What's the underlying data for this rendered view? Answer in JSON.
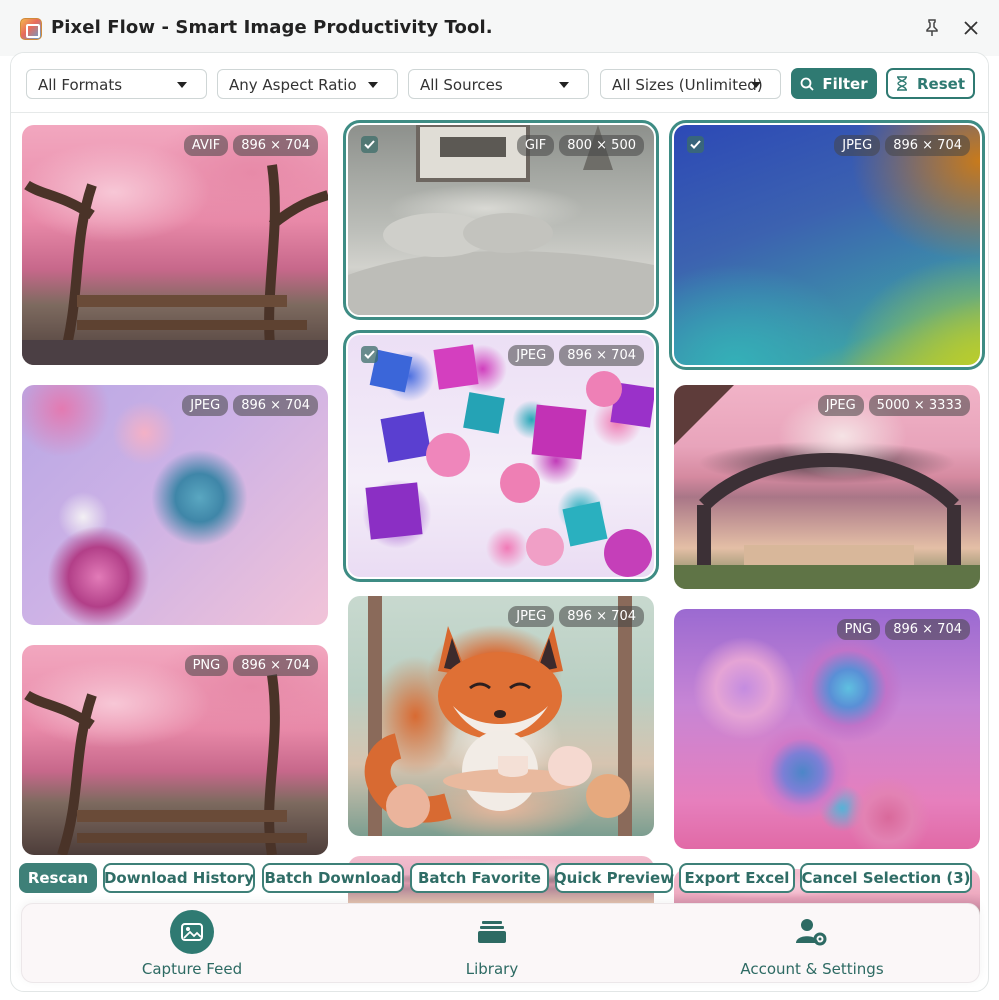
{
  "window": {
    "title": "Pixel Flow - Smart Image Productivity Tool.",
    "pin_icon": "pin-icon",
    "close_icon": "close-icon"
  },
  "filters": {
    "format": "All Formats",
    "aspect": "Any Aspect Ratio",
    "source": "All Sources",
    "size": "All Sizes (Unlimited)",
    "filter_label": "Filter",
    "reset_label": "Reset"
  },
  "images": [
    {
      "format": "AVIF",
      "dims": "896 × 704",
      "selected": false,
      "subject": "cherry blossom trees over wooden bridge"
    },
    {
      "format": "GIF",
      "dims": "800 × 500",
      "selected": true,
      "subject": "grey bedroom with pillows"
    },
    {
      "format": "JPEG",
      "dims": "896 × 704",
      "selected": true,
      "subject": "blue-orange-green gradient"
    },
    {
      "format": "JPEG",
      "dims": "896 × 704",
      "selected": false,
      "subject": "pastel spheres"
    },
    {
      "format": "JPEG",
      "dims": "896 × 704",
      "selected": true,
      "subject": "pink and blue cubes and spheres"
    },
    {
      "format": "JPEG",
      "dims": "5000 × 3333",
      "selected": false,
      "subject": "cherry blossom arched bridge"
    },
    {
      "format": "PNG",
      "dims": "896 × 704",
      "selected": false,
      "subject": "cherry blossom trees over wooden bridge"
    },
    {
      "format": "JPEG",
      "dims": "896 × 704",
      "selected": false,
      "subject": "fox having tea"
    },
    {
      "format": "PNG",
      "dims": "896 × 704",
      "selected": false,
      "subject": "purple and blue spheres"
    }
  ],
  "actions": {
    "rescan": "Rescan",
    "download_history": "Download History",
    "batch_download": "Batch Download",
    "batch_favorite": "Batch Favorite",
    "quick_preview": "Quick Preview",
    "export_excel": "Export Excel",
    "cancel_selection": "Cancel Selection (3)"
  },
  "nav": {
    "capture_feed": "Capture Feed",
    "library": "Library",
    "account_settings": "Account & Settings"
  },
  "colors": {
    "accent": "#2f7a72",
    "selection_outline": "#3e8c84"
  }
}
